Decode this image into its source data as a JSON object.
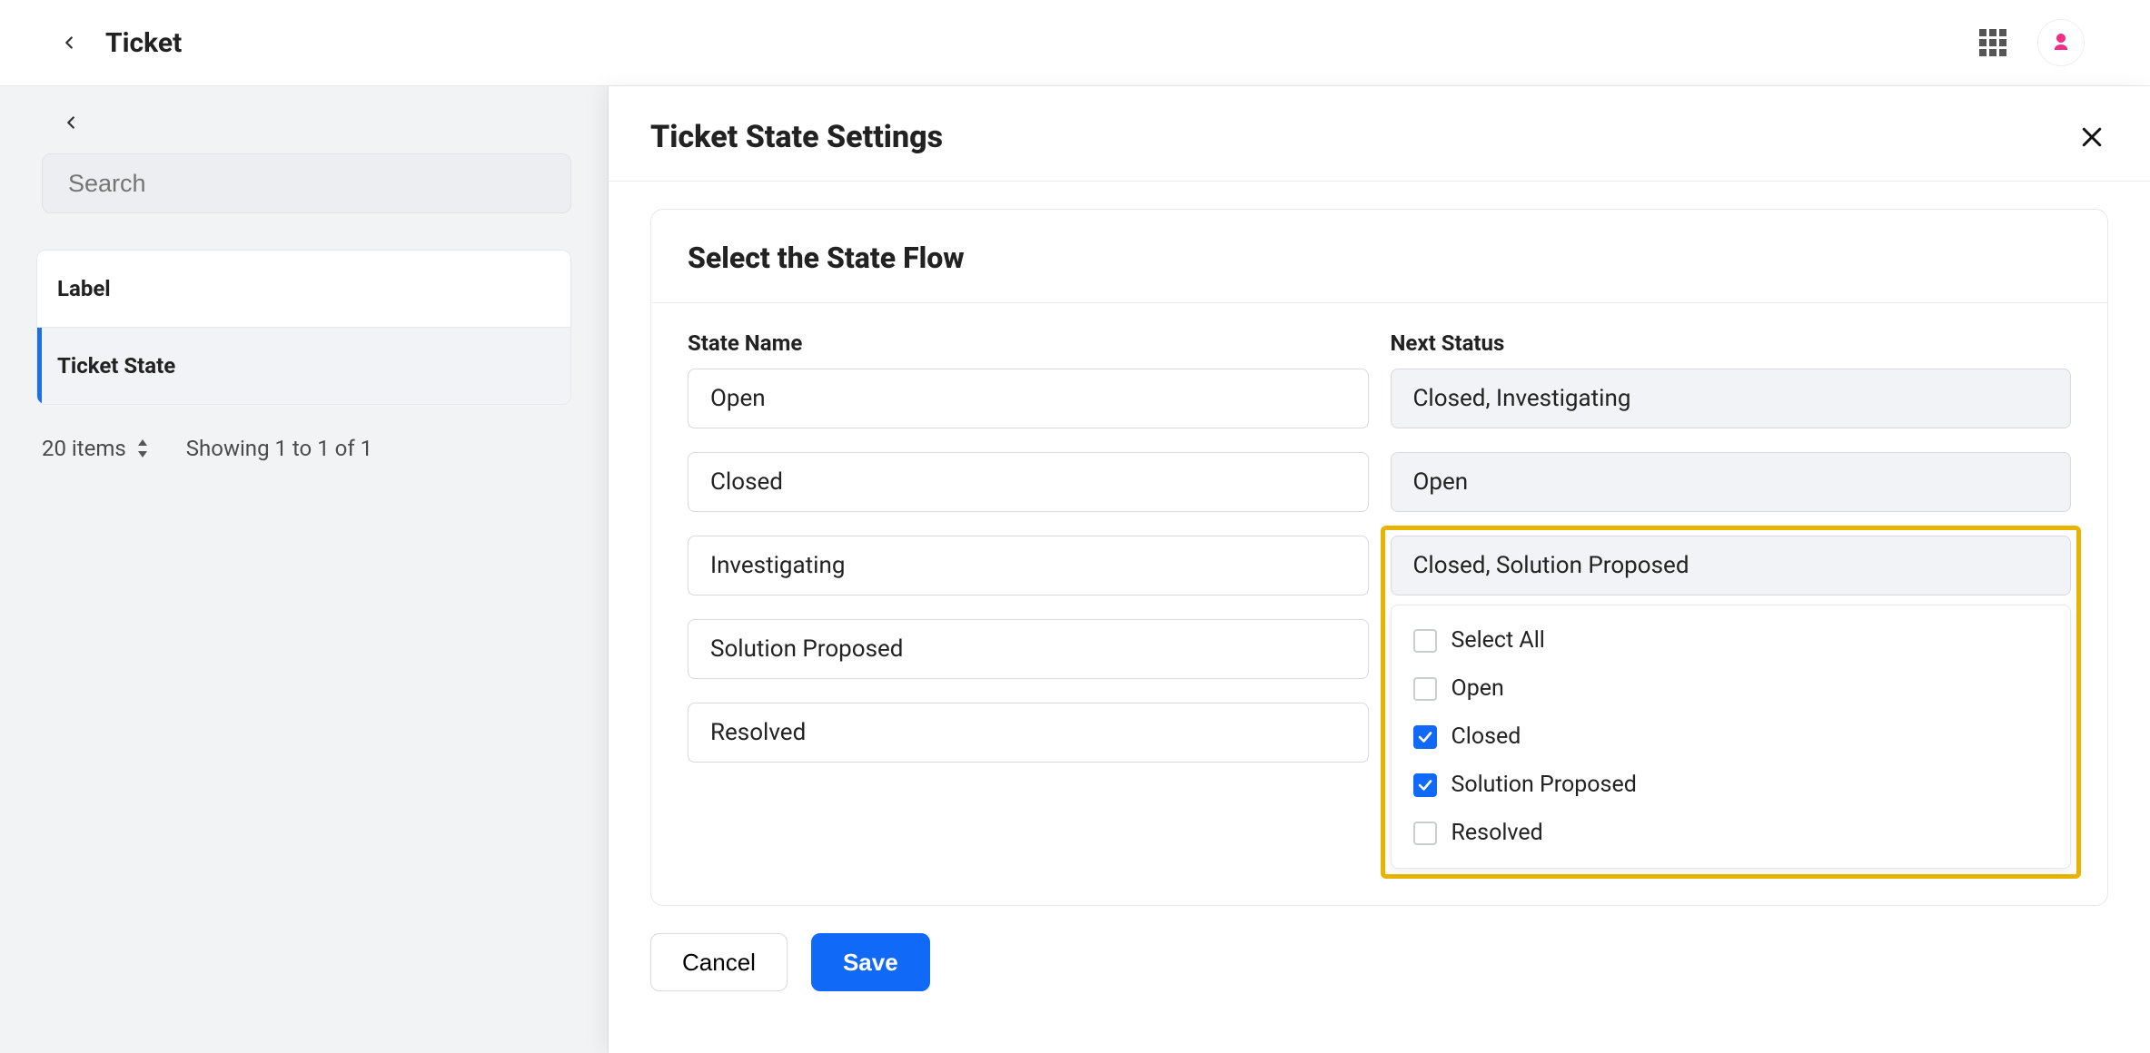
{
  "topbar": {
    "title": "Ticket"
  },
  "sidebar": {
    "search_placeholder": "Search",
    "header": "Label",
    "items": [
      {
        "label": "Ticket State",
        "active": true
      }
    ],
    "footer_count": "20 items",
    "footer_showing": "Showing 1 to 1 of 1"
  },
  "panel": {
    "title": "Ticket State Settings",
    "card_title": "Select the State Flow",
    "columns": {
      "state_name": "State Name",
      "next_status": "Next Status"
    },
    "rows": [
      {
        "state": "Open",
        "next": "Closed, Investigating",
        "highlighted": false
      },
      {
        "state": "Closed",
        "next": "Open",
        "highlighted": false
      },
      {
        "state": "Investigating",
        "next": "Closed, Solution Proposed",
        "highlighted": true
      },
      {
        "state": "Solution Proposed",
        "next": "",
        "highlighted": false
      },
      {
        "state": "Resolved",
        "next": "",
        "highlighted": false
      }
    ],
    "dropdown": {
      "options": [
        {
          "label": "Select All",
          "checked": false
        },
        {
          "label": "Open",
          "checked": false
        },
        {
          "label": "Closed",
          "checked": true
        },
        {
          "label": "Solution Proposed",
          "checked": true
        },
        {
          "label": "Resolved",
          "checked": false
        }
      ]
    },
    "buttons": {
      "cancel": "Cancel",
      "save": "Save"
    }
  }
}
